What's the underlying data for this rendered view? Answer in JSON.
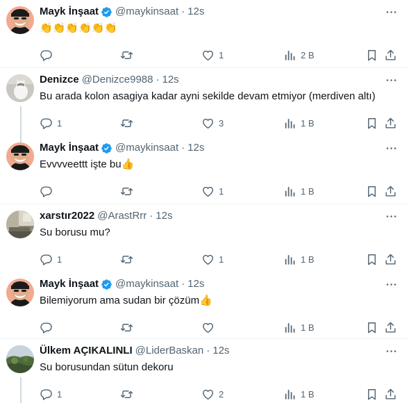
{
  "colors": {
    "text": "#0f1419",
    "secondary": "#536471",
    "verified": "#1d9bf0",
    "divider": "#eff3f4",
    "thread_line": "#cfd9de"
  },
  "tweets": [
    {
      "name": "Mayk İnşaat",
      "handle": "@maykinsaat",
      "dot": "·",
      "time": "12s",
      "verified": true,
      "avatar_icon": "masked-person-avatar",
      "text": "👏👏👏👏👏👏",
      "reply_count": "",
      "retweet_count": "",
      "like_count": "1",
      "view_count": "2 B"
    },
    {
      "name": "Denizce",
      "handle": "@Denizce9988",
      "dot": "·",
      "time": "12s",
      "verified": false,
      "avatar_icon": "cat-photo-avatar",
      "text": "Bu arada kolon asagiya kadar ayni sekilde devam etmiyor (merdiven altı)",
      "reply_count": "1",
      "retweet_count": "",
      "like_count": "3",
      "view_count": "1 B"
    },
    {
      "name": "Mayk İnşaat",
      "handle": "@maykinsaat",
      "dot": "·",
      "time": "12s",
      "verified": true,
      "avatar_icon": "masked-person-avatar",
      "text": "Evvvveettt işte bu👍",
      "reply_count": "",
      "retweet_count": "",
      "like_count": "1",
      "view_count": "1 B"
    },
    {
      "name": "xarstır2022",
      "handle": "@ArastRrr",
      "dot": "·",
      "time": "12s",
      "verified": false,
      "avatar_icon": "room-photo-avatar",
      "text": "Su borusu mu?",
      "reply_count": "1",
      "retweet_count": "",
      "like_count": "1",
      "view_count": "1 B"
    },
    {
      "name": "Mayk İnşaat",
      "handle": "@maykinsaat",
      "dot": "·",
      "time": "12s",
      "verified": true,
      "avatar_icon": "masked-person-avatar",
      "text": "Bilemiyorum ama sudan bir çözüm👍",
      "reply_count": "",
      "retweet_count": "",
      "like_count": "",
      "view_count": "1 B"
    },
    {
      "name": "Ülkem AÇIKALINLI",
      "handle": "@LiderBaskan",
      "dot": "·",
      "time": "12s",
      "verified": false,
      "avatar_icon": "landscape-photo-avatar",
      "text": "Su borusundan sütun dekoru",
      "reply_count": "1",
      "retweet_count": "",
      "like_count": "2",
      "view_count": "1 B"
    }
  ]
}
